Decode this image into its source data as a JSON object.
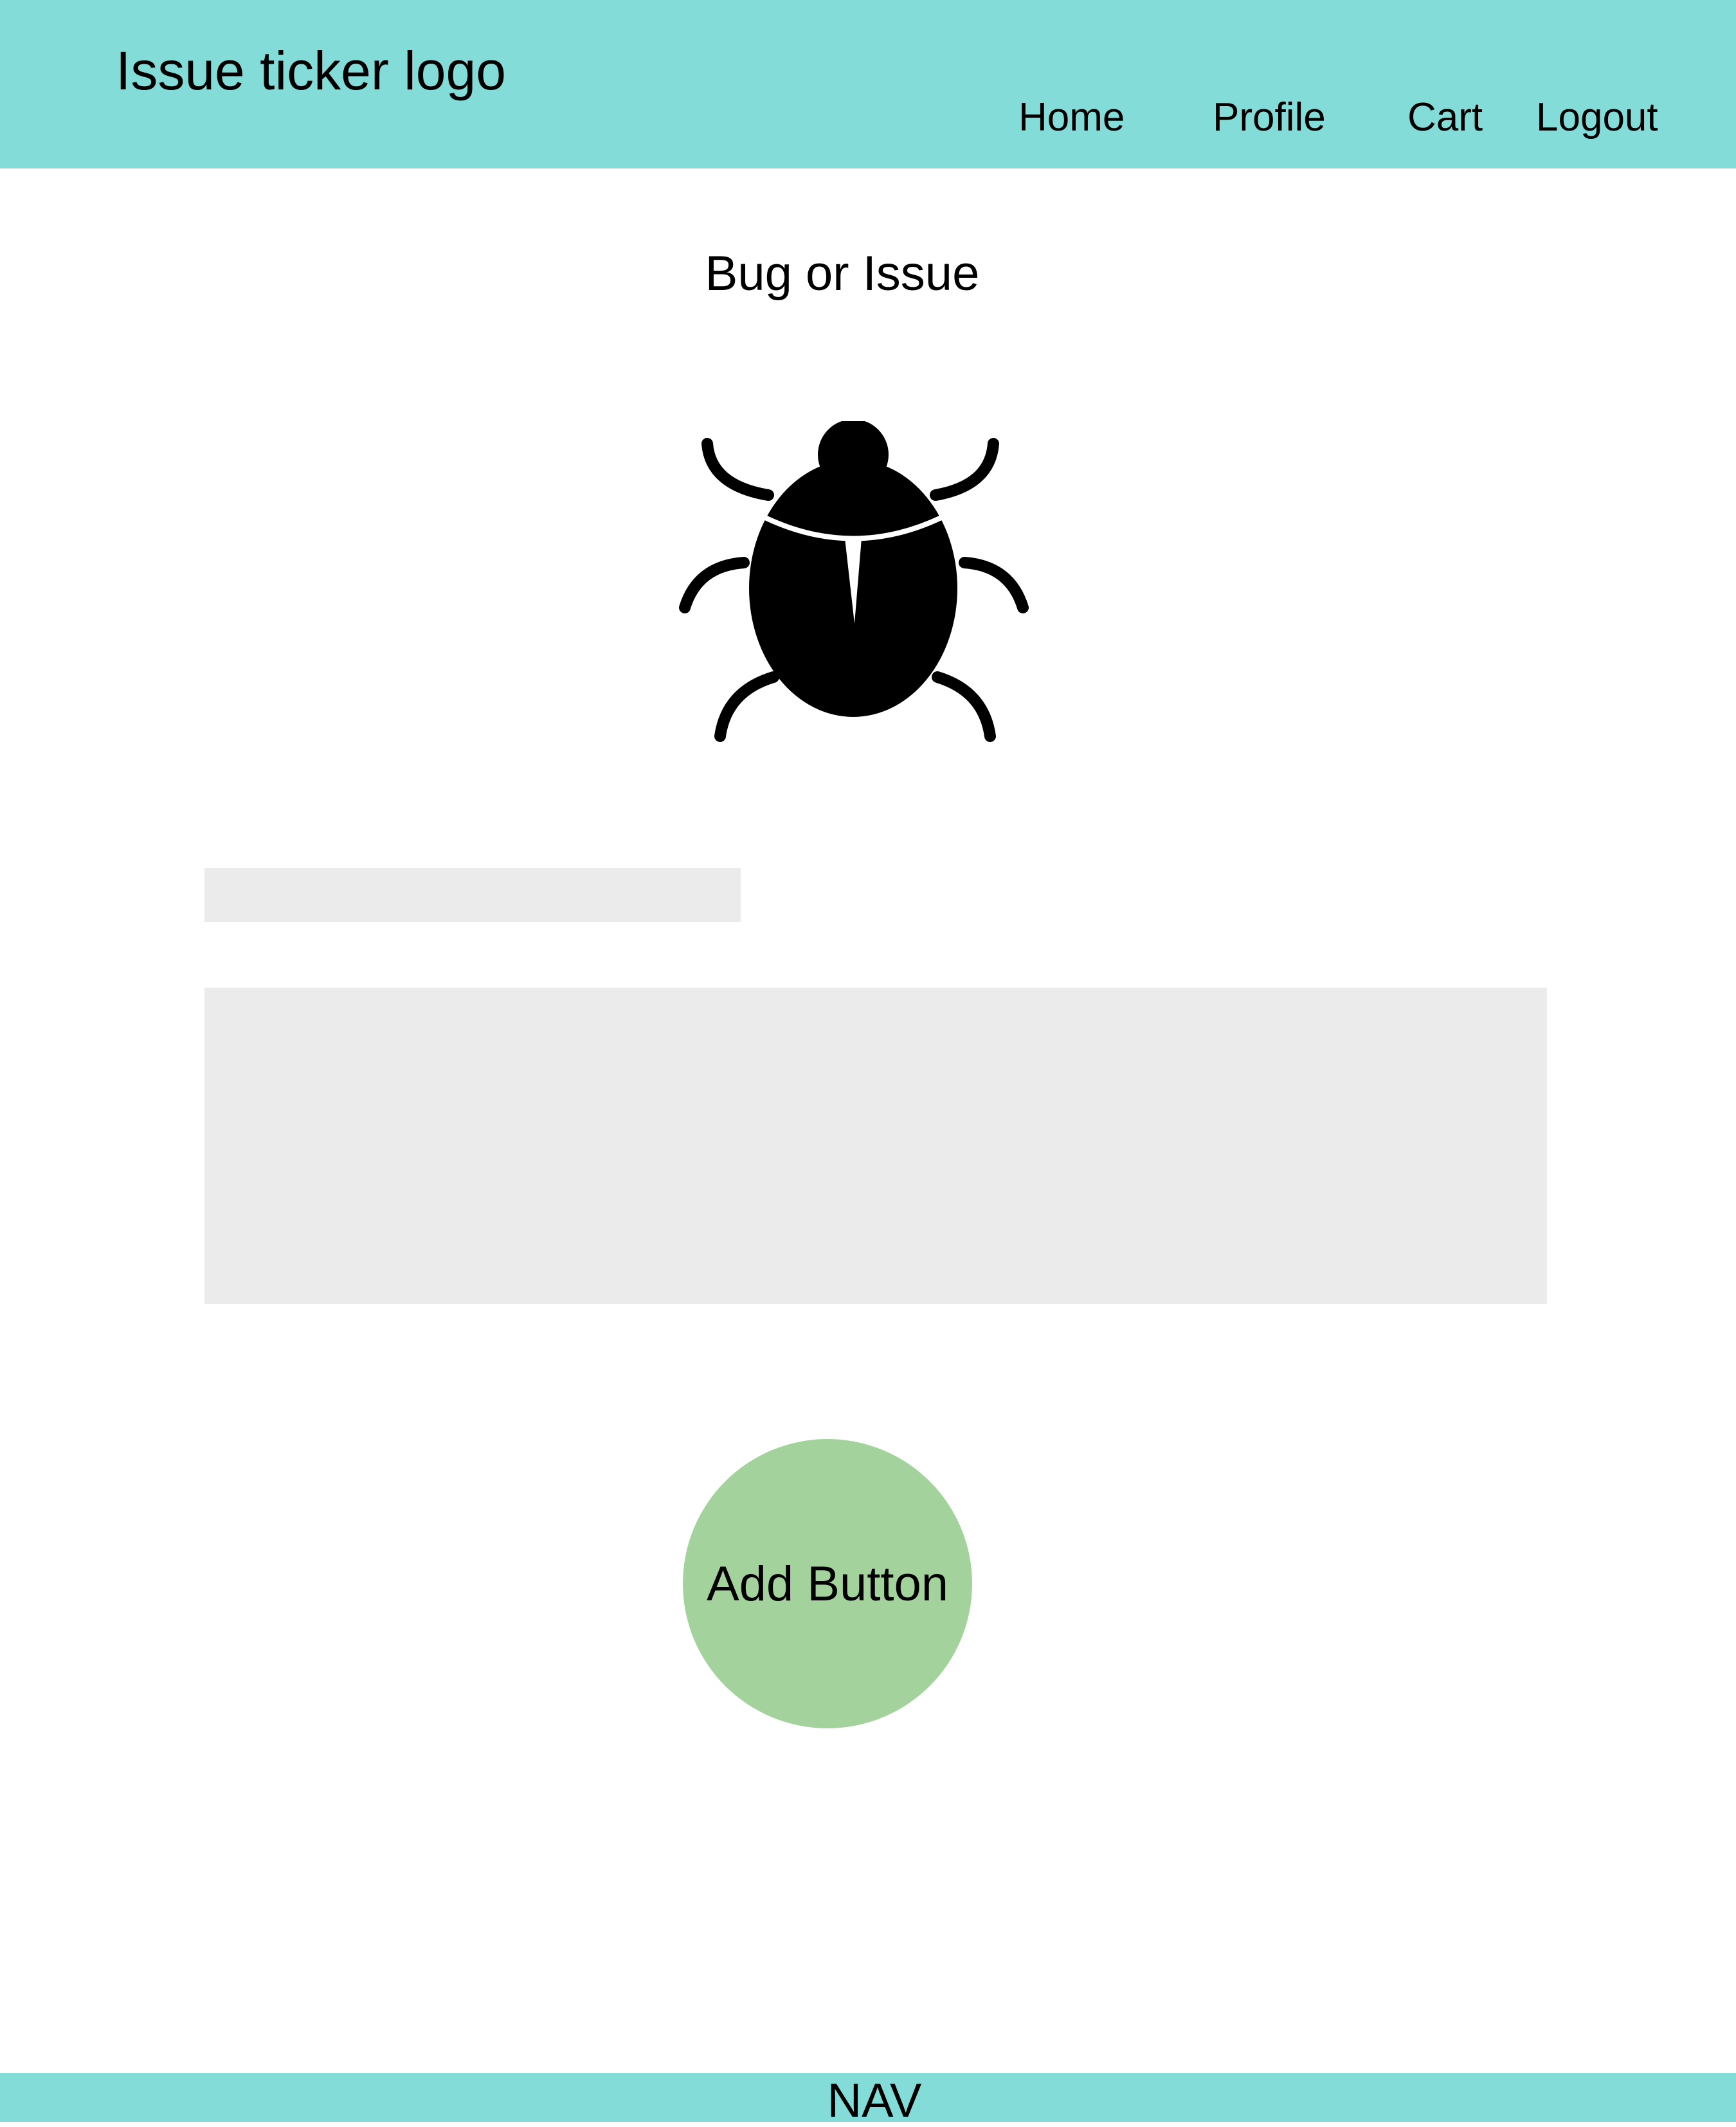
{
  "header": {
    "logo_text": "Issue ticker logo",
    "nav": [
      {
        "label": "Home"
      },
      {
        "label": "Profile"
      },
      {
        "label": "Cart"
      },
      {
        "label": "Logout"
      }
    ]
  },
  "main": {
    "title": "Bug or Issue",
    "icon": "bug-icon",
    "title_input": {
      "value": "",
      "placeholder": ""
    },
    "description_input": {
      "value": "",
      "placeholder": ""
    },
    "add_button_label": "Add Button"
  },
  "footer": {
    "label": "NAV"
  },
  "colors": {
    "header_bg": "#83dcd8",
    "footer_bg": "#83dcd8",
    "input_bg": "#ebebeb",
    "add_button_bg": "#a3d29c"
  }
}
